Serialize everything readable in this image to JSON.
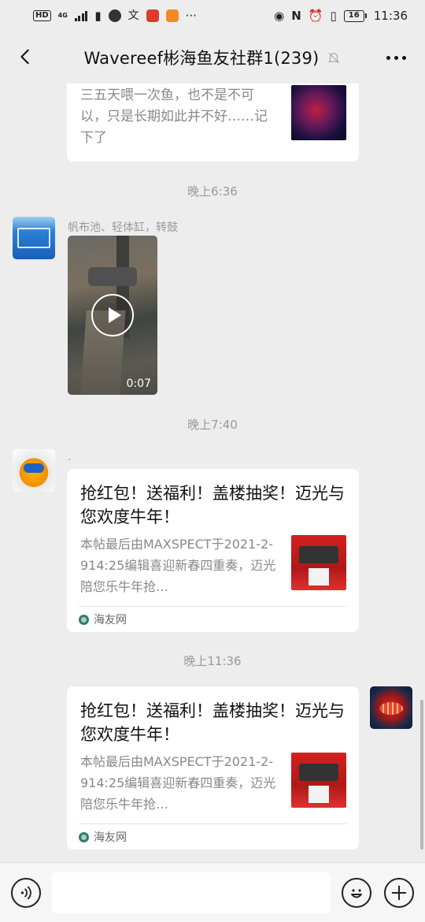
{
  "status_bar": {
    "hd": "HD",
    "network": "4G",
    "time": "11:36",
    "battery": "16"
  },
  "nav": {
    "title": "Wavereef彬海鱼友社群1(239)"
  },
  "messages": {
    "card_top": {
      "text": "三五天喂一次鱼，也不是不可以，只是长期如此并不好……记下了"
    },
    "time_1": "晚上6:36",
    "video_msg": {
      "sender": "帆布池、轻体缸，转鼓",
      "duration": "0:07"
    },
    "time_2": "晚上7:40",
    "link_1": {
      "sender": ".",
      "title": "抢红包！送福利！盖楼抽奖！迈光与您欢度牛年！",
      "desc": "本帖最后由MAXSPECT于2021-2-914:25编辑喜迎新春四重奏，迈光陪您乐牛年抢…",
      "source": "海友网"
    },
    "time_3": "晚上11:36",
    "link_2": {
      "title": "抢红包！送福利！盖楼抽奖！迈光与您欢度牛年！",
      "desc": "本帖最后由MAXSPECT于2021-2-914:25编辑喜迎新春四重奏，迈光陪您乐牛年抢…",
      "source": "海友网"
    }
  },
  "input": {
    "placeholder": ""
  },
  "icons": {
    "back": "back-arrow-icon",
    "mute": "mute-bell-icon",
    "more": "more-icon",
    "voice": "voice-icon",
    "emoji": "emoji-icon",
    "plus": "plus-icon"
  },
  "colors": {
    "background": "#ededed",
    "card": "#ffffff",
    "muted_text": "#999999"
  }
}
